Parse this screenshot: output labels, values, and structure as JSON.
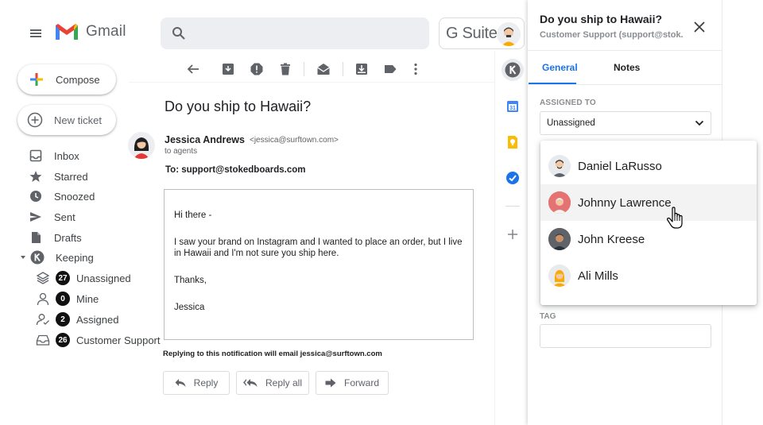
{
  "header": {
    "app_name": "Gmail",
    "suite_label": "G Suite",
    "search_placeholder": ""
  },
  "sidebar": {
    "compose_label": "Compose",
    "new_ticket_label": "New ticket",
    "items": [
      {
        "label": "Inbox",
        "icon": "inbox-icon"
      },
      {
        "label": "Starred",
        "icon": "star-icon"
      },
      {
        "label": "Snoozed",
        "icon": "clock-icon"
      },
      {
        "label": "Sent",
        "icon": "send-icon"
      },
      {
        "label": "Drafts",
        "icon": "draft-icon"
      },
      {
        "label": "Keeping",
        "icon": "keeping-logo-icon"
      }
    ],
    "sub_items": [
      {
        "label": "Unassigned",
        "count": "27",
        "icon": "layers-icon"
      },
      {
        "label": "Mine",
        "count": "0",
        "icon": "person-icon"
      },
      {
        "label": "Assigned",
        "count": "2",
        "icon": "person-check-icon"
      },
      {
        "label": "Customer Support",
        "count": "26",
        "icon": "inbox-tray-icon"
      }
    ]
  },
  "message": {
    "subject": "Do you ship to Hawaii?",
    "sender_name": "Jessica Andrews",
    "sender_email": "<jessica@surftown.com>",
    "to_meta": "to agents",
    "to_line": "To: support@stokedboards.com",
    "body": {
      "greeting": "Hi there -",
      "paragraph": "I saw your brand on Instagram and I wanted to place an order, but I live in Hawaii and I'm not sure you ship here.",
      "closing": "Thanks,",
      "signature": "Jessica"
    },
    "reply_note": "Replying to this notification will email jessica@surftown.com",
    "actions": {
      "reply": "Reply",
      "reply_all": "Reply all",
      "forward": "Forward"
    }
  },
  "panel": {
    "title": "Do you ship to Hawaii?",
    "subtitle": "Customer Support (support@stok...",
    "tabs": [
      {
        "label": "General",
        "active": true
      },
      {
        "label": "Notes",
        "active": false
      }
    ],
    "assigned_to_label": "ASSIGNED TO",
    "assigned_value": "Unassigned",
    "assignee_options": [
      {
        "name": "Daniel LaRusso",
        "hovered": false
      },
      {
        "name": "Johnny Lawrence",
        "hovered": true
      },
      {
        "name": "John Kreese",
        "hovered": false
      },
      {
        "name": "Ali Mills",
        "hovered": false
      }
    ],
    "tag_label": "TAG"
  },
  "colors": {
    "accent": "#1a73e8",
    "gmail_red": "#ea4335",
    "badge_bg": "#111111"
  }
}
